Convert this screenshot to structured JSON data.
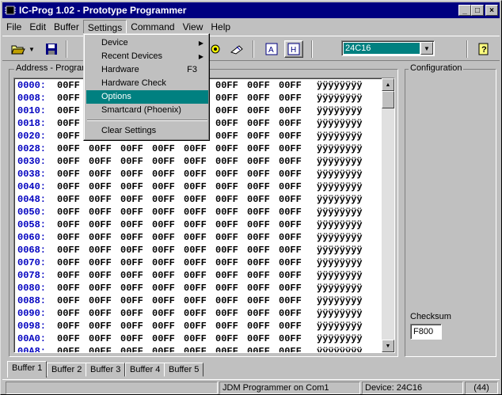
{
  "window": {
    "title": "IC-Prog 1.02 - Prototype Programmer",
    "minimize": "_",
    "maximize": "□",
    "close": "×"
  },
  "menubar": {
    "items": [
      "File",
      "Edit",
      "Buffer",
      "Settings",
      "Command",
      "View",
      "Help"
    ],
    "active": "Settings"
  },
  "settings_menu": {
    "items": [
      {
        "label": "Device",
        "shortcut": "",
        "submenu": true
      },
      {
        "label": "Recent Devices",
        "shortcut": "",
        "submenu": true
      },
      {
        "label": "Hardware",
        "shortcut": "F3",
        "submenu": false
      },
      {
        "label": "Hardware Check",
        "shortcut": "",
        "submenu": false
      },
      {
        "label": "Options",
        "shortcut": "",
        "submenu": false,
        "highlighted": true
      },
      {
        "label": "Smartcard (Phoenix)",
        "shortcut": "",
        "submenu": false
      },
      {
        "label": "Clear Settings",
        "shortcut": "",
        "submenu": false
      }
    ]
  },
  "toolbar": {
    "icons": [
      "open-icon",
      "dropdown-arrow-icon",
      "save-icon",
      "read-icon",
      "erase-icon",
      "assembler-view-icon",
      "hex-view-icon",
      "help-icon"
    ],
    "device": "24C16"
  },
  "program_group": {
    "legend": "Address - Program"
  },
  "hex": {
    "addresses": [
      "0000:",
      "0008:",
      "0010:",
      "0018:",
      "0020:",
      "0028:",
      "0030:",
      "0038:",
      "0040:",
      "0048:",
      "0050:",
      "0058:",
      "0060:",
      "0068:",
      "0070:",
      "0078:",
      "0080:",
      "0088:",
      "0090:",
      "0098:",
      "00A0:",
      "00A8:"
    ],
    "word": "00FF",
    "ascii": "ÿÿÿÿÿÿÿÿ"
  },
  "config": {
    "legend": "Configuration",
    "checksum_label": "Checksum",
    "checksum_value": "F800"
  },
  "tabs": [
    "Buffer 1",
    "Buffer 2",
    "Buffer 3",
    "Buffer 4",
    "Buffer 5"
  ],
  "status": {
    "programmer": "JDM Programmer on Com1",
    "device": "Device: 24C16",
    "code": "(44)"
  }
}
